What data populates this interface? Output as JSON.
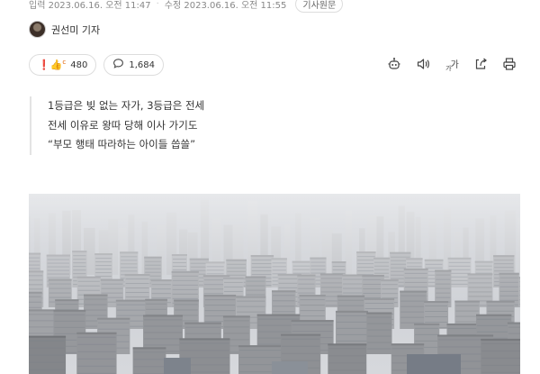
{
  "article": {
    "published": "입력 2023.06.16. 오전 11:47",
    "modified": "수정 2023.06.16. 오전 11:55",
    "original_button": "기사원문",
    "reporter": "권선미 기자",
    "reaction_count": "480",
    "comment_count": "1,684",
    "font_size_label": "가",
    "subtitle": [
      "1등급은 빚 없는 자가, 3등급은 전세",
      "전세 이유로 왕따 당해 이사 가기도",
      "“부모 행태 따라하는 아이들 씁쓸”"
    ]
  },
  "icons": {
    "reaction": "reaction-emoji-icon",
    "comment": "comment-icon",
    "summary": "summary-robot-icon",
    "audio": "speaker-icon",
    "font_size": "font-size-icon",
    "share": "share-icon",
    "print": "print-icon"
  },
  "photo": {
    "subject": "hazy aerial view of dense apartment complexes"
  }
}
